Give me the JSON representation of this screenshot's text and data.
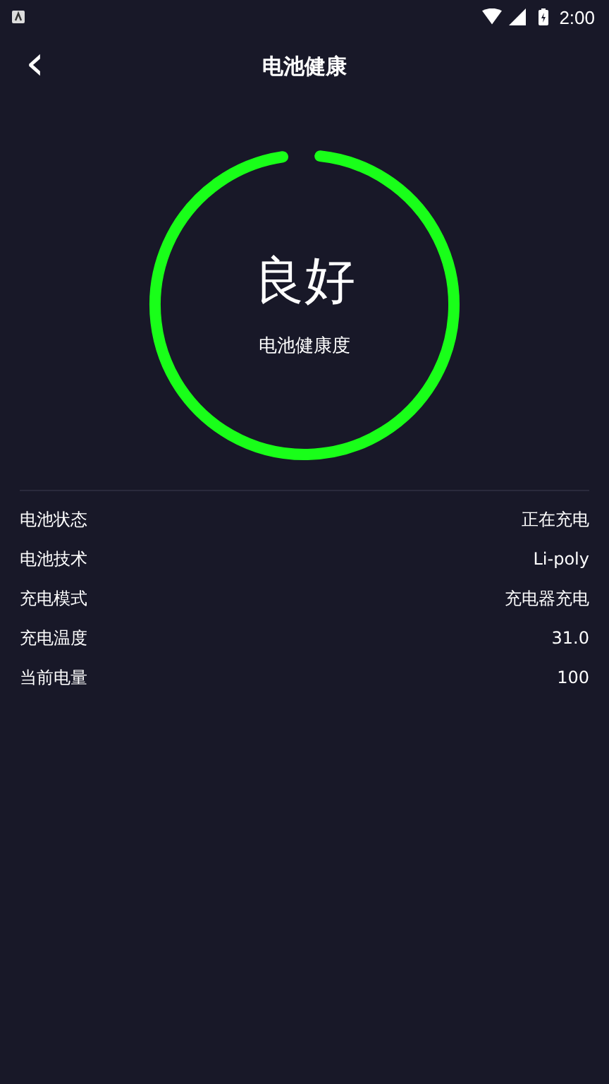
{
  "status_bar": {
    "time": "2:00"
  },
  "header": {
    "back": "‹",
    "title": "电池健康"
  },
  "health": {
    "status": "良好",
    "label": "电池健康度"
  },
  "details": [
    {
      "label": "电池状态",
      "value": "正在充电"
    },
    {
      "label": "电池技术",
      "value": "Li-poly"
    },
    {
      "label": "充电模式",
      "value": "充电器充电"
    },
    {
      "label": "充电温度",
      "value": "31.0"
    },
    {
      "label": "当前电量",
      "value": "100"
    }
  ]
}
